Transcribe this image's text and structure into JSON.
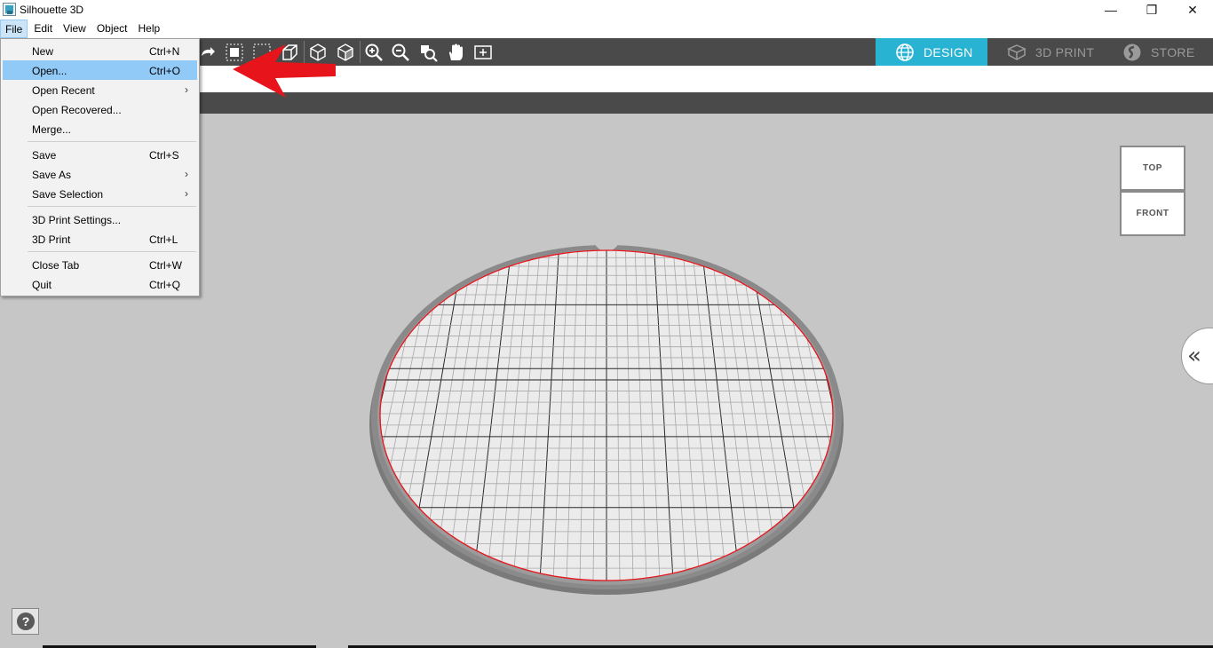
{
  "window": {
    "title": "Silhouette 3D",
    "minimize": "—",
    "restore": "❐",
    "close": "✕"
  },
  "menubar": {
    "items": [
      "File",
      "Edit",
      "View",
      "Object",
      "Help"
    ]
  },
  "nav_tabs": {
    "design": "DESIGN",
    "print": "3D PRINT",
    "store": "STORE"
  },
  "file_menu": {
    "new": {
      "label": "New",
      "shortcut": "Ctrl+N"
    },
    "open": {
      "label": "Open...",
      "shortcut": "Ctrl+O"
    },
    "open_recent": {
      "label": "Open Recent"
    },
    "open_recovered": {
      "label": "Open Recovered..."
    },
    "merge": {
      "label": "Merge..."
    },
    "save": {
      "label": "Save",
      "shortcut": "Ctrl+S"
    },
    "save_as": {
      "label": "Save As"
    },
    "save_selection": {
      "label": "Save Selection"
    },
    "print_settings": {
      "label": "3D Print Settings..."
    },
    "print": {
      "label": "3D Print",
      "shortcut": "Ctrl+L"
    },
    "close_tab": {
      "label": "Close Tab",
      "shortcut": "Ctrl+W"
    },
    "quit": {
      "label": "Quit",
      "shortcut": "Ctrl+Q"
    },
    "submenu_arrow": "›"
  },
  "view_cube": {
    "top": "TOP",
    "front": "FRONT"
  },
  "collapse_panel": "«",
  "help": "?",
  "colors": {
    "toolbar": "#4a4a4a",
    "accent": "#29b3d3",
    "viewport": "#c6c6c6",
    "menu_highlight": "#91c9f7",
    "annotation_arrow": "#e8141b",
    "plate_outline": "#e8141b"
  }
}
